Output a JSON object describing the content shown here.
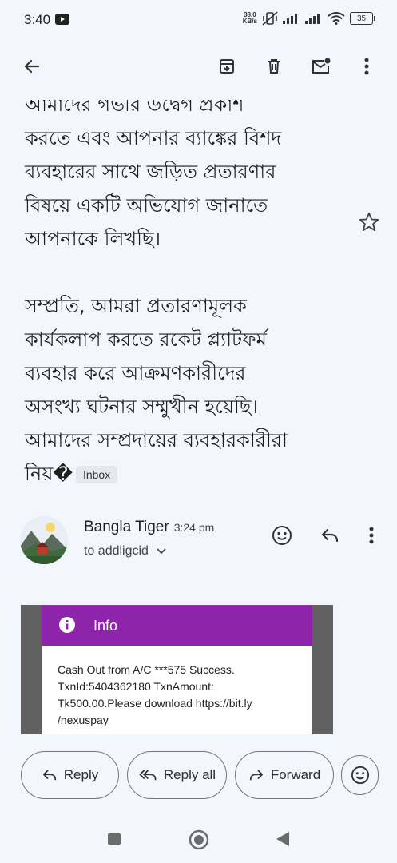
{
  "status_bar": {
    "time": "3:40",
    "net_speed_value": "38.0",
    "net_speed_unit": "KB/s",
    "battery": "35"
  },
  "toolbar": {
    "back_icon": "arrow-back-icon",
    "archive_icon": "archive-icon",
    "delete_icon": "trash-icon",
    "mark_unread_icon": "mail-unread-icon",
    "more_icon": "more-vert-icon"
  },
  "message": {
    "lines_para1": [
      "আমাদের গভীর উদ্বেগ প্রকাশ",
      "করতে এবং আপনার ব্যাঙ্কের বিশদ",
      "ব্যবহারের সাথে জড়িত প্রতারণার",
      "বিষয়ে একটি অভিযোগ জানাতে",
      "আপনাকে লিখছি।"
    ],
    "lines_para2": [
      "সম্প্রতি, আমরা প্রতারণামূলক",
      "কার্যকলাপ করতে রকেট প্ল্যাটফর্ম",
      "ব্যবহার করে আক্রমণকারীদের",
      "অসংখ্য ঘটনার সম্মুখীন হয়েছি।",
      "আমাদের সম্প্রদায়ের ব্যবহারকারীরা"
    ],
    "last_line": "নিয়�",
    "label_chip": "Inbox"
  },
  "sender": {
    "name": "Bangla Tiger",
    "time": "3:24 pm",
    "recipient": "to addligcid"
  },
  "attachment": {
    "header": "Info",
    "text_lines": [
      "Cash Out from A/C ***575 Success.",
      "TxnId:5404362180 TxnAmount:",
      "Tk500.00.Please download https://bit.ly",
      "/nexuspay"
    ],
    "accent_color": "#8e24aa"
  },
  "actions": {
    "reply": "Reply",
    "reply_all": "Reply all",
    "forward": "Forward"
  },
  "colors": {
    "background": "#f3f6fc",
    "text": "#1f1f1f"
  }
}
